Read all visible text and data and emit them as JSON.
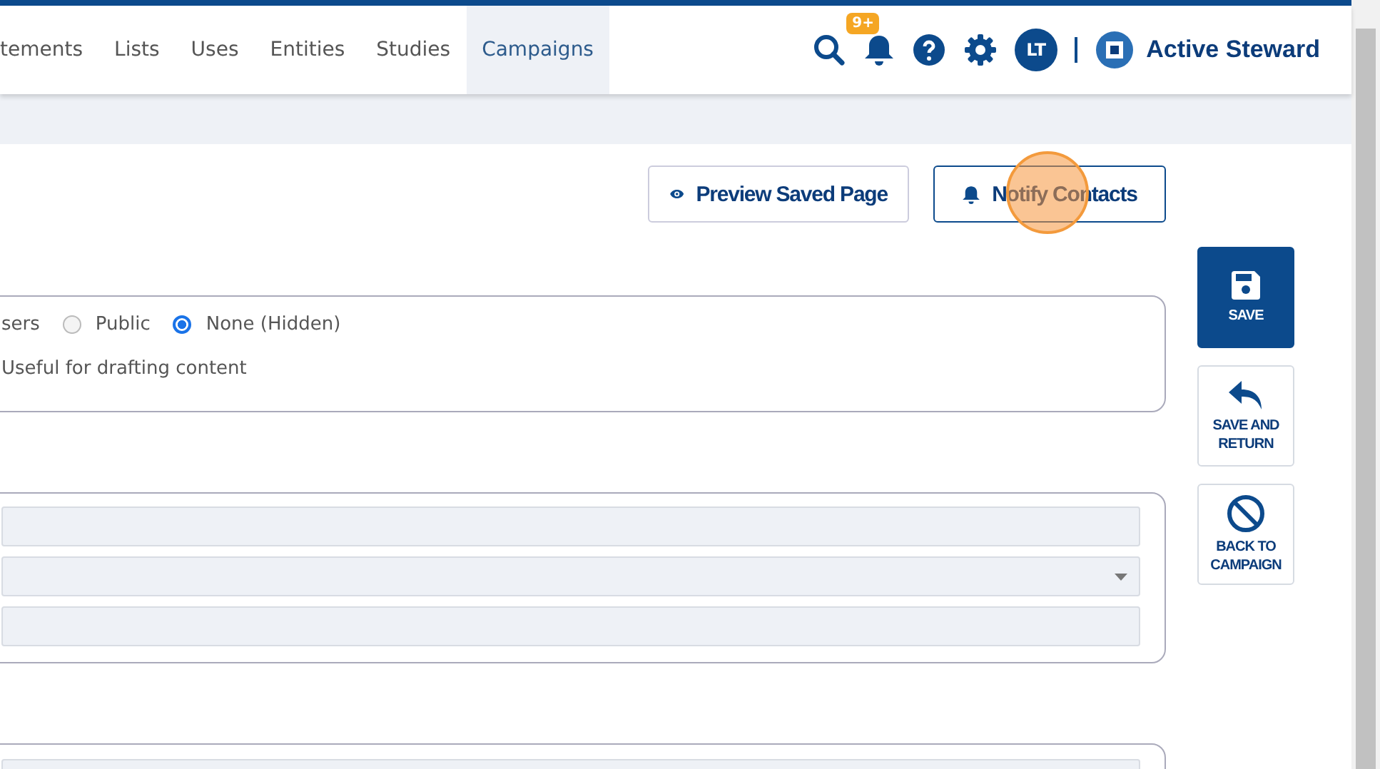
{
  "nav": {
    "items": [
      {
        "label": "tements",
        "selected": false
      },
      {
        "label": "Lists",
        "selected": false
      },
      {
        "label": "Uses",
        "selected": false
      },
      {
        "label": "Entities",
        "selected": false
      },
      {
        "label": "Studies",
        "selected": false
      },
      {
        "label": "Campaigns",
        "selected": true
      }
    ],
    "notification_badge": "9+",
    "avatar": "LT",
    "brand": "Active Steward"
  },
  "actions": [
    {
      "label": "Preview Saved Page",
      "kind": "eye"
    },
    {
      "label": "Notify Contacts",
      "kind": "bell"
    }
  ],
  "visibility": {
    "cut_option_label": "sers",
    "options": [
      {
        "label": "Public",
        "selected": false
      },
      {
        "label": "None (Hidden)",
        "selected": true
      }
    ],
    "hint": "Useful for drafting content"
  },
  "fields": [
    {
      "kind": "text"
    },
    {
      "kind": "select"
    },
    {
      "kind": "text"
    }
  ],
  "side_buttons": [
    {
      "label": "SAVE",
      "kind": "save",
      "primary": true
    },
    {
      "label": "SAVE AND RETURN",
      "kind": "return",
      "primary": false
    },
    {
      "label": "BACK TO CAMPAIGN",
      "kind": "cancel",
      "primary": false
    }
  ]
}
